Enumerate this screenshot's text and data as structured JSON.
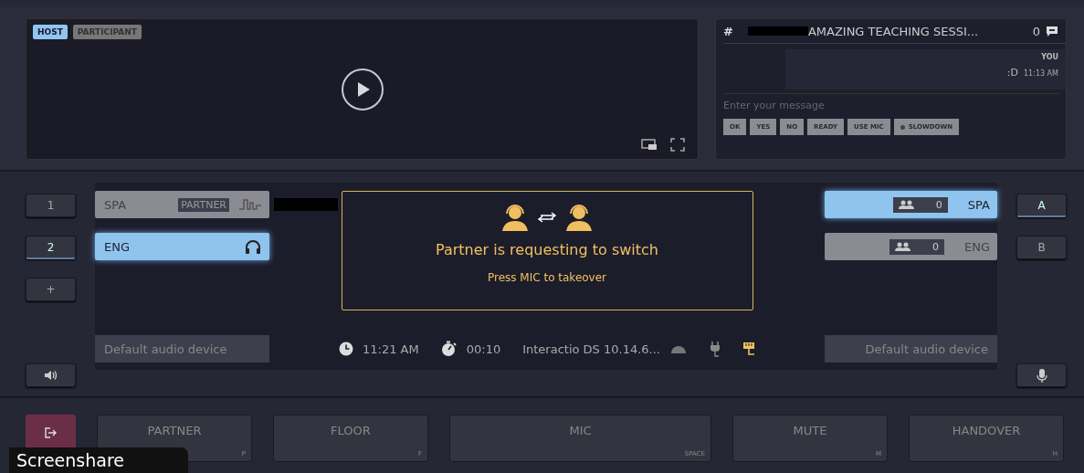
{
  "video": {
    "role_tabs": [
      {
        "label": "HOST",
        "selected": true
      },
      {
        "label": "PARTICIPANT",
        "selected": false
      }
    ]
  },
  "chat": {
    "hash": "#",
    "title": "AMAZING TEACHING SESSI...",
    "count": "0",
    "messages": [
      {
        "author": "YOU",
        "text": ":D",
        "time": "11:13 AM"
      }
    ],
    "placeholder": "Enter your message",
    "quick_replies": [
      {
        "label": "OK",
        "kind": "text"
      },
      {
        "label": "YES",
        "kind": "text"
      },
      {
        "label": "NO",
        "kind": "text"
      },
      {
        "label": "READY",
        "kind": "text"
      },
      {
        "label": "USE MIC",
        "kind": "text"
      },
      {
        "label": "SLOWDOWN",
        "kind": "dot"
      }
    ]
  },
  "channel_keys": [
    {
      "label": "1",
      "selected": false
    },
    {
      "label": "2",
      "selected": true
    },
    {
      "label": "+",
      "selected": false
    }
  ],
  "floor_channels": [
    {
      "label": "SPA",
      "badge": "PARTNER",
      "kind": "partner",
      "selected": false
    },
    {
      "label": "ENG",
      "kind": "listening",
      "selected": true
    }
  ],
  "notice": {
    "title": "Partner is requesting to switch",
    "hint": "Press MIC to takeover"
  },
  "status": {
    "time": "11:21 AM",
    "timer": "00:10",
    "app": "Interactio DS 10.14.6..."
  },
  "output_channels": [
    {
      "label": "SPA",
      "count": "0",
      "selected": true
    },
    {
      "label": "ENG",
      "count": "0",
      "selected": false
    }
  ],
  "output_keys": [
    {
      "label": "A",
      "selected": true
    },
    {
      "label": "B",
      "selected": false
    }
  ],
  "speaker_device": "Default audio device",
  "mic_device": "Default audio device",
  "actions": [
    {
      "label": "PARTNER",
      "key": "P"
    },
    {
      "label": "FLOOR",
      "key": "F"
    },
    {
      "label": "MIC",
      "key": "SPACE"
    },
    {
      "label": "MUTE",
      "key": "M"
    },
    {
      "label": "HANDOVER",
      "key": "H"
    }
  ],
  "overlay": {
    "label": "Screenshare"
  }
}
